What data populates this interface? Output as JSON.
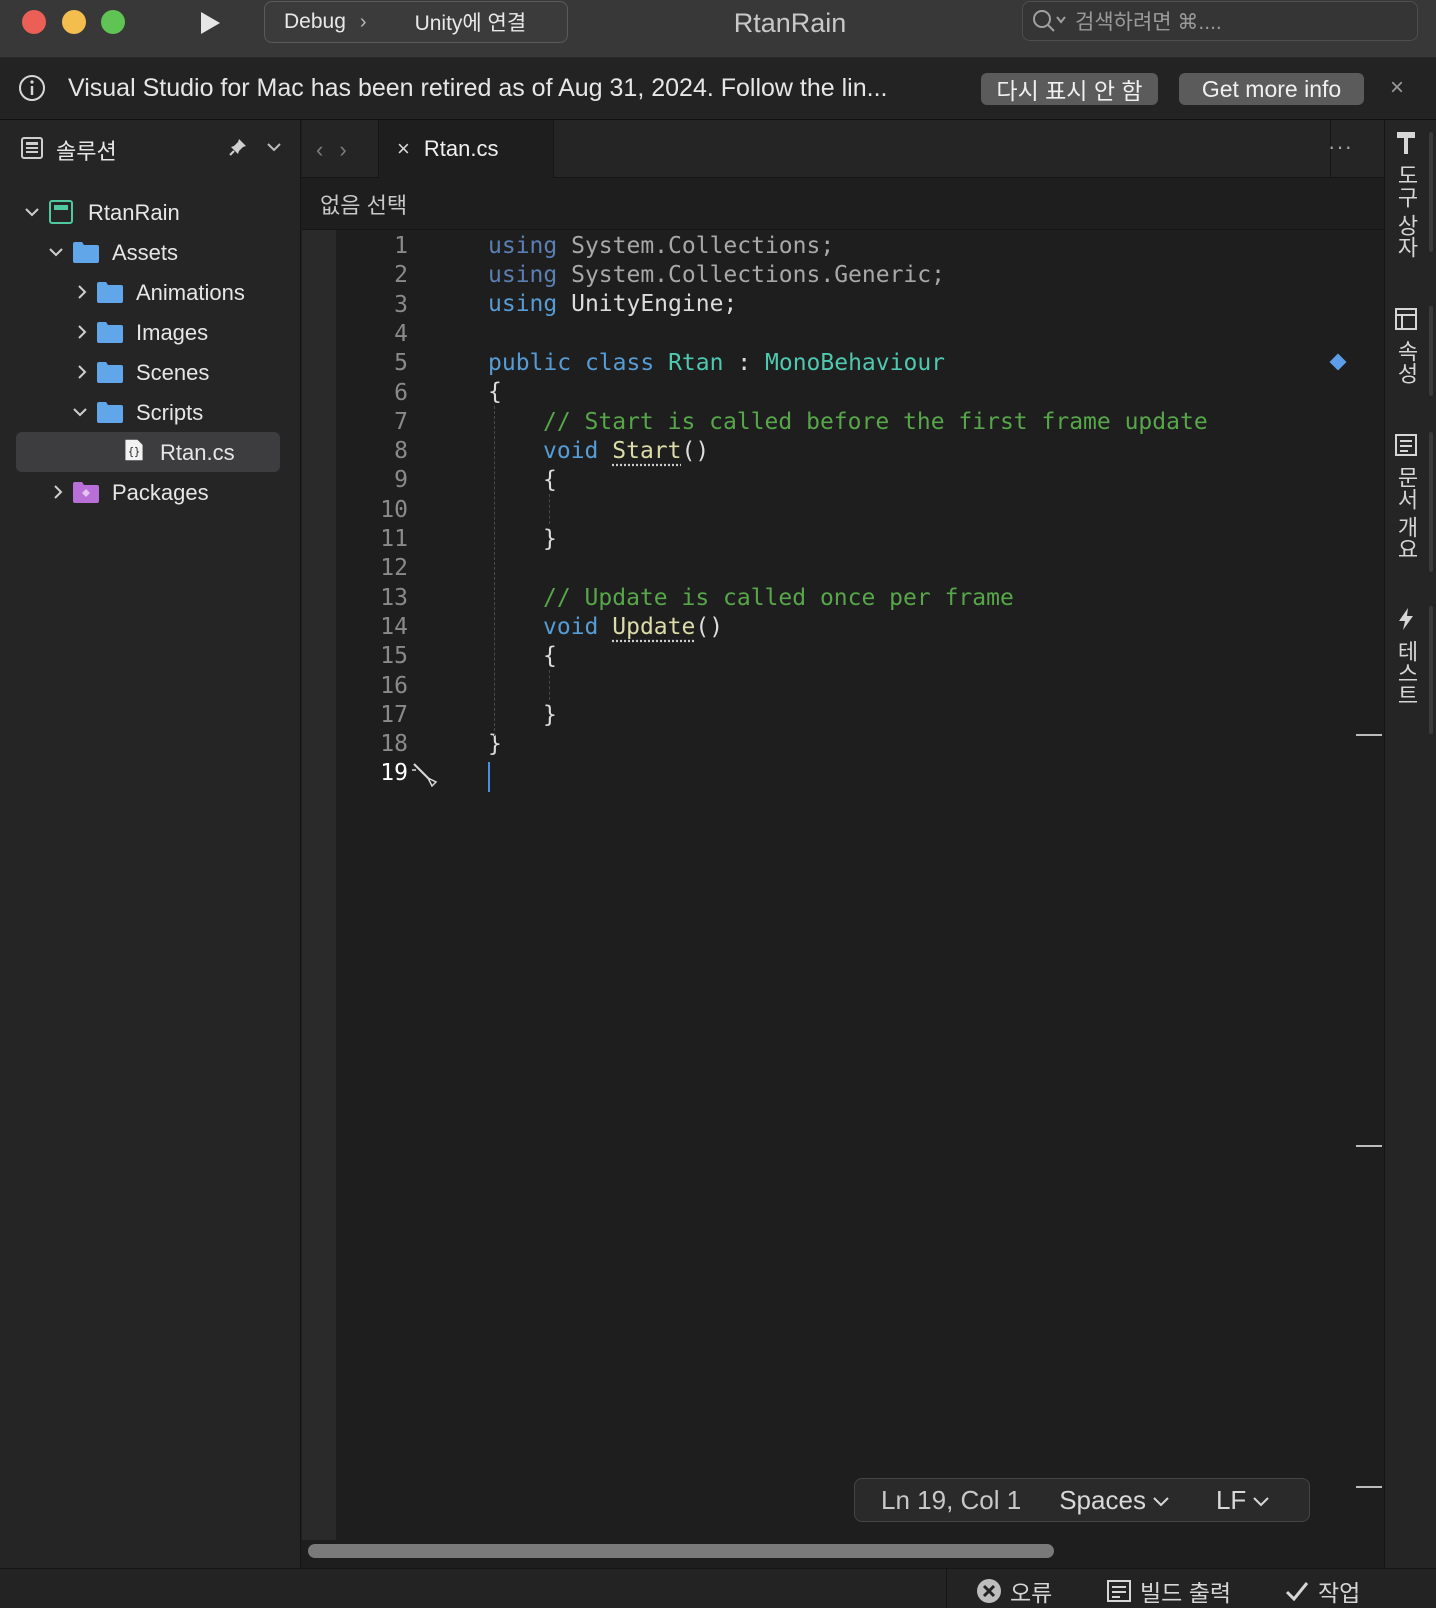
{
  "titlebar": {
    "config": "Debug",
    "target": "Unity에 연결",
    "app_title": "RtanRain",
    "search_placeholder": "검색하려면 ⌘...."
  },
  "notification": {
    "message": "Visual Studio for Mac has been retired as of Aug 31, 2024. Follow the lin...",
    "dismiss_label": "다시 표시 안 함",
    "more_label": "Get more info",
    "close_label": "×"
  },
  "solution": {
    "title": "솔루션",
    "tree": [
      {
        "label": "RtanRain",
        "type": "project"
      },
      {
        "label": "Assets",
        "type": "folder"
      },
      {
        "label": "Animations",
        "type": "folder"
      },
      {
        "label": "Images",
        "type": "folder"
      },
      {
        "label": "Scenes",
        "type": "folder"
      },
      {
        "label": "Scripts",
        "type": "folder"
      },
      {
        "label": "Rtan.cs",
        "type": "file",
        "selected": true
      },
      {
        "label": "Packages",
        "type": "packages"
      }
    ]
  },
  "editor": {
    "tab_name": "Rtan.cs",
    "tab_close": "×",
    "breadcrumb": "없음 선택",
    "more_label": "···",
    "current_line": 19,
    "line_numbers": [
      "1",
      "2",
      "3",
      "4",
      "5",
      "6",
      "7",
      "8",
      "9",
      "10",
      "11",
      "12",
      "13",
      "14",
      "15",
      "16",
      "17",
      "18",
      "19"
    ],
    "code": {
      "l1_kw": "using",
      "l1_rest": " System.Collections;",
      "l2_kw": "using",
      "l2_rest": " System.Collections.Generic;",
      "l3_kw": "using",
      "l3_rest": " UnityEngine;",
      "l5_kw1": "public",
      "l5_kw2": "class",
      "l5_type": "Rtan",
      "l5_colon": " : ",
      "l5_base": "MonoBehaviour",
      "l6": "{",
      "l7": "// Start is called before the first frame update",
      "l8_kw": "void",
      "l8_fn": "Start",
      "l8_paren": "()",
      "l9": "{",
      "l11": "}",
      "l13": "// Update is called once per frame",
      "l14_kw": "void",
      "l14_fn": "Update",
      "l14_paren": "()",
      "l15": "{",
      "l17": "}",
      "l18": "}"
    }
  },
  "status": {
    "position": "Ln 19, Col 1",
    "indent": "Spaces",
    "line_ending": "LF"
  },
  "right_pads": {
    "toolbox": "도구 상자",
    "properties": "속성",
    "outline": "문서 개요",
    "tests": "테스트"
  },
  "bottom": {
    "errors": "오류",
    "build_output": "빌드 출력",
    "tasks": "작업"
  },
  "colors": {
    "keyword": "#569cd6",
    "type": "#4ec9b0",
    "comment": "#57a64a",
    "function": "#dcdcaa",
    "close_red": "#ec5f56",
    "minimize_yellow": "#f4be4f",
    "zoom_green": "#5fc454"
  }
}
